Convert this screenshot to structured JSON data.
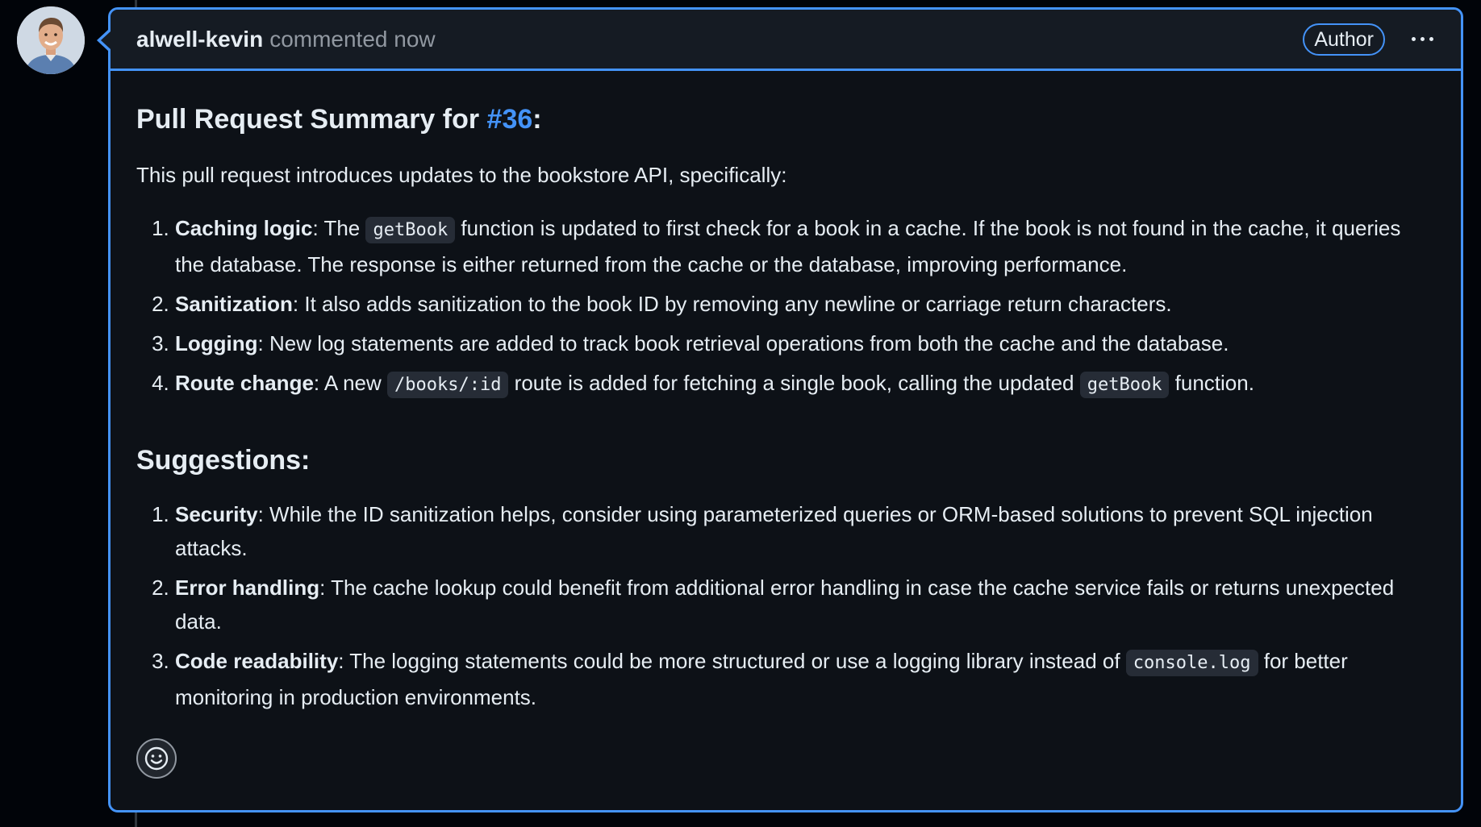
{
  "comment": {
    "author": "alwell-kevin",
    "action": "commented",
    "time": "now",
    "badge": "Author",
    "menu_icon": "kebab-horizontal-icon",
    "reaction_icon": "smiley-icon"
  },
  "summary": {
    "heading_prefix": "Pull Request Summary for ",
    "issue_ref": "#36",
    "heading_suffix": ":",
    "intro": "This pull request introduces updates to the bookstore API, specifically:",
    "items": [
      {
        "title": "Caching logic",
        "pre": ": The ",
        "code": "getBook",
        "post": " function is updated to first check for a book in a cache. If the book is not found in the cache, it queries the database. The response is either returned from the cache or the database, improving performance."
      },
      {
        "title": "Sanitization",
        "text": ": It also adds sanitization to the book ID by removing any newline or carriage return characters."
      },
      {
        "title": "Logging",
        "text": ": New log statements are added to track book retrieval operations from both the cache and the database."
      },
      {
        "title": "Route change",
        "pre": ": A new ",
        "code": "/books/:id",
        "mid": " route is added for fetching a single book, calling the updated ",
        "code2": "getBook",
        "post": " function."
      }
    ]
  },
  "suggestions": {
    "heading": "Suggestions:",
    "items": [
      {
        "title": "Security",
        "text": ": While the ID sanitization helps, consider using parameterized queries or ORM-based solutions to prevent SQL injection attacks."
      },
      {
        "title": "Error handling",
        "text": ": The cache lookup could benefit from additional error handling in case the cache service fails or returns unexpected data."
      },
      {
        "title": "Code readability",
        "pre": ": The logging statements could be more structured or use a logging library instead of ",
        "code": "console.log",
        "post": " for better monitoring in production environments."
      }
    ]
  },
  "colors": {
    "accent": "#4493f8",
    "background": "#0d1117",
    "header_background": "#151b23",
    "code_background": "#262c36"
  }
}
